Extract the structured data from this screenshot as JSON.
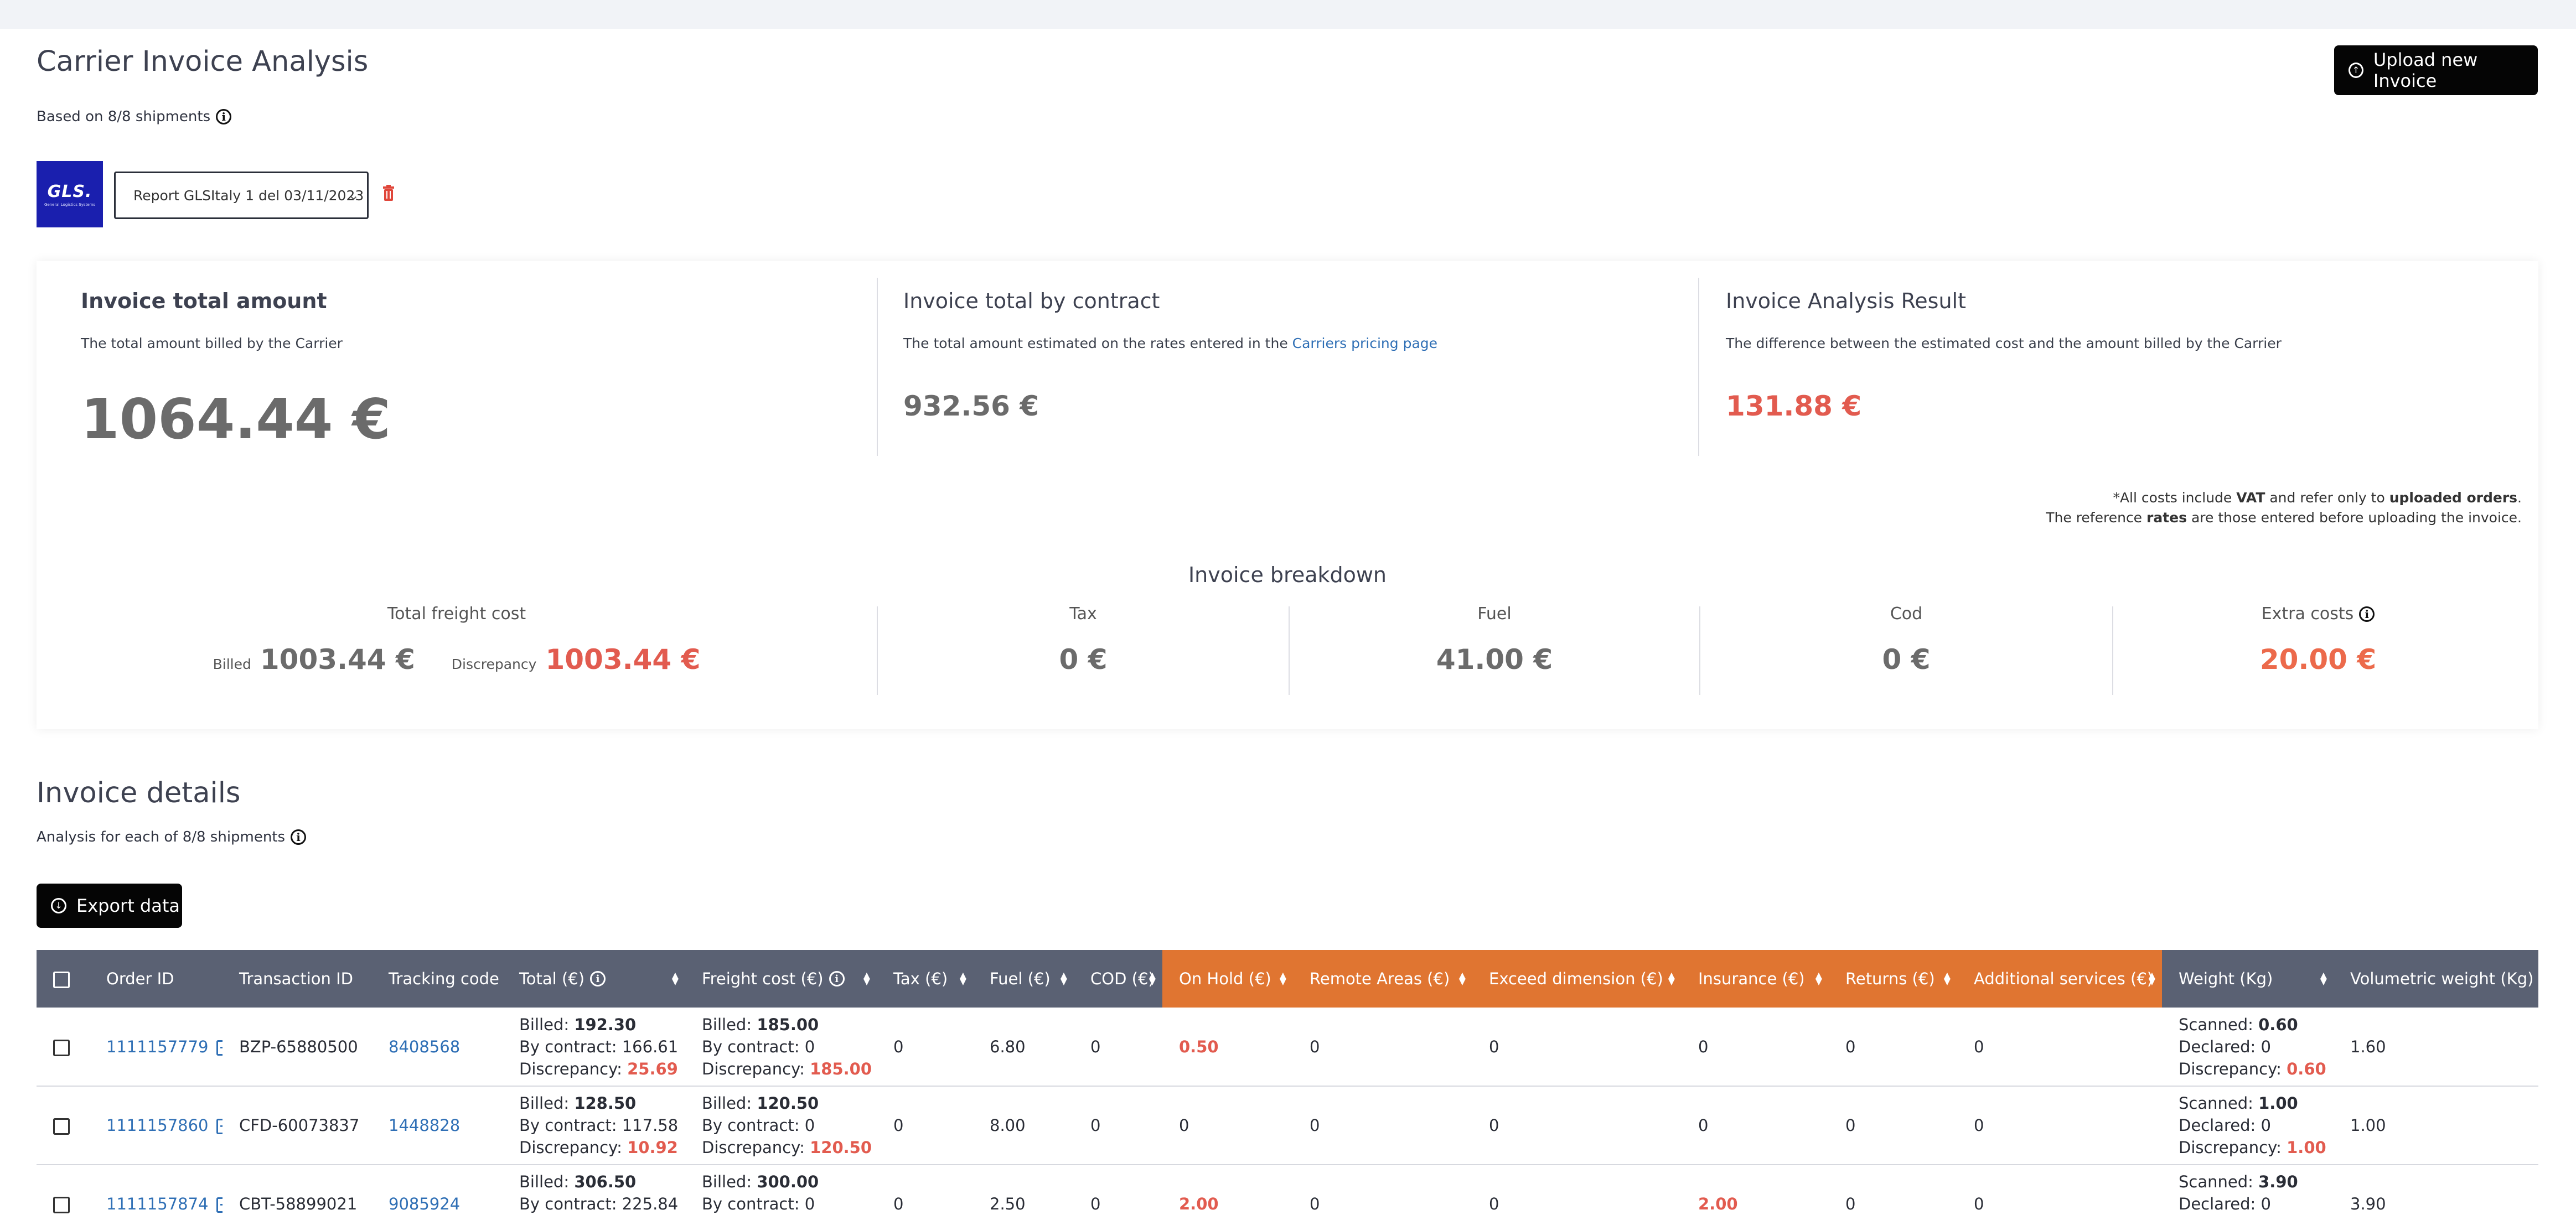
{
  "header": {
    "title": "Carrier Invoice Analysis",
    "subtitle": "Based on 8/8 shipments",
    "upload_label": "Upload new Invoice"
  },
  "carrier": {
    "logo_text": "GLS.",
    "logo_subtext": "General Logistics Systems",
    "report_selected": "Report GLSItaly 1 del 03/11/2023"
  },
  "summary": {
    "total": {
      "title": "Invoice total amount",
      "desc": "The total amount billed by the Carrier",
      "value": "1064.44 €"
    },
    "contract": {
      "title": "Invoice total by contract",
      "desc_prefix": "The total amount estimated on the rates entered in the",
      "link": "Carriers pricing page",
      "value": "932.56 €"
    },
    "result": {
      "title": "Invoice Analysis Result",
      "desc": "The difference between the estimated cost and the amount billed by the Carrier",
      "value": "131.88 €"
    },
    "note_line1_a": "*All costs include ",
    "note_line1_b": "VAT",
    "note_line1_c": " and refer only to ",
    "note_line1_d": "uploaded orders",
    "note_line1_e": ".",
    "note_line2_a": "The reference ",
    "note_line2_b": "rates",
    "note_line2_c": " are those entered before uploading the invoice."
  },
  "breakdown": {
    "title": "Invoice breakdown",
    "freight_label": "Total freight cost",
    "billed_label": "Billed",
    "billed_value": "1003.44 €",
    "discrepancy_label": "Discrepancy",
    "discrepancy_value": "1003.44 €",
    "tax_label": "Tax",
    "tax_value": "0 €",
    "fuel_label": "Fuel",
    "fuel_value": "41.00 €",
    "cod_label": "Cod",
    "cod_value": "0 €",
    "extra_label": "Extra costs",
    "extra_value": "20.00 €"
  },
  "details": {
    "title": "Invoice details",
    "subtitle": "Analysis for each of 8/8 shipments",
    "export_label": "Export data"
  },
  "table": {
    "headers": {
      "order_id": "Order ID",
      "transaction_id": "Transaction ID",
      "tracking": "Tracking code",
      "total": "Total (€)",
      "freight": "Freight cost (€)",
      "tax": "Tax (€)",
      "fuel": "Fuel (€)",
      "cod": "COD (€)",
      "on_hold": "On Hold (€)",
      "remote": "Remote Areas (€)",
      "exceed": "Exceed dimension (€)",
      "insurance": "Insurance (€)",
      "returns": "Returns (€)",
      "additional": "Additional services (€)",
      "weight": "Weight (Kg)",
      "volumetric": "Volumetric weight (Kg)"
    },
    "labels": {
      "billed": "Billed: ",
      "by_contract": "By contract: ",
      "discrepancy": "Discrepancy: ",
      "scanned": "Scanned: ",
      "declared": "Declared: "
    },
    "rows": [
      {
        "order_id": "1111157779",
        "transaction_id": "BZP-65880500",
        "tracking": "8408568",
        "total_billed": "192.30",
        "total_contract": "166.61",
        "total_disc": "25.69",
        "freight_billed": "185.00",
        "freight_contract": "0",
        "freight_disc": "185.00",
        "tax": "0",
        "fuel": "6.80",
        "cod": "0",
        "on_hold": "0.50",
        "remote": "0",
        "exceed": "0",
        "insurance": "0",
        "returns": "0",
        "additional": "0",
        "scanned": "0.60",
        "declared": "0",
        "weight_disc": "0.60",
        "volumetric": "1.60"
      },
      {
        "order_id": "1111157860",
        "transaction_id": "CFD-60073837",
        "tracking": "1448828",
        "total_billed": "128.50",
        "total_contract": "117.58",
        "total_disc": "10.92",
        "freight_billed": "120.50",
        "freight_contract": "0",
        "freight_disc": "120.50",
        "tax": "0",
        "fuel": "8.00",
        "cod": "0",
        "on_hold": "0",
        "remote": "0",
        "exceed": "0",
        "insurance": "0",
        "returns": "0",
        "additional": "0",
        "scanned": "1.00",
        "declared": "0",
        "weight_disc": "1.00",
        "volumetric": "1.00"
      },
      {
        "order_id": "1111157874",
        "transaction_id": "CBT-58899021",
        "tracking": "9085924",
        "total_billed": "306.50",
        "total_contract": "225.84",
        "total_disc": "",
        "freight_billed": "300.00",
        "freight_contract": "0",
        "freight_disc": "",
        "tax": "0",
        "fuel": "2.50",
        "cod": "0",
        "on_hold": "2.00",
        "remote": "0",
        "exceed": "0",
        "insurance": "2.00",
        "returns": "0",
        "additional": "0",
        "scanned": "3.90",
        "declared": "0",
        "weight_disc": "",
        "volumetric": "3.90"
      }
    ]
  }
}
